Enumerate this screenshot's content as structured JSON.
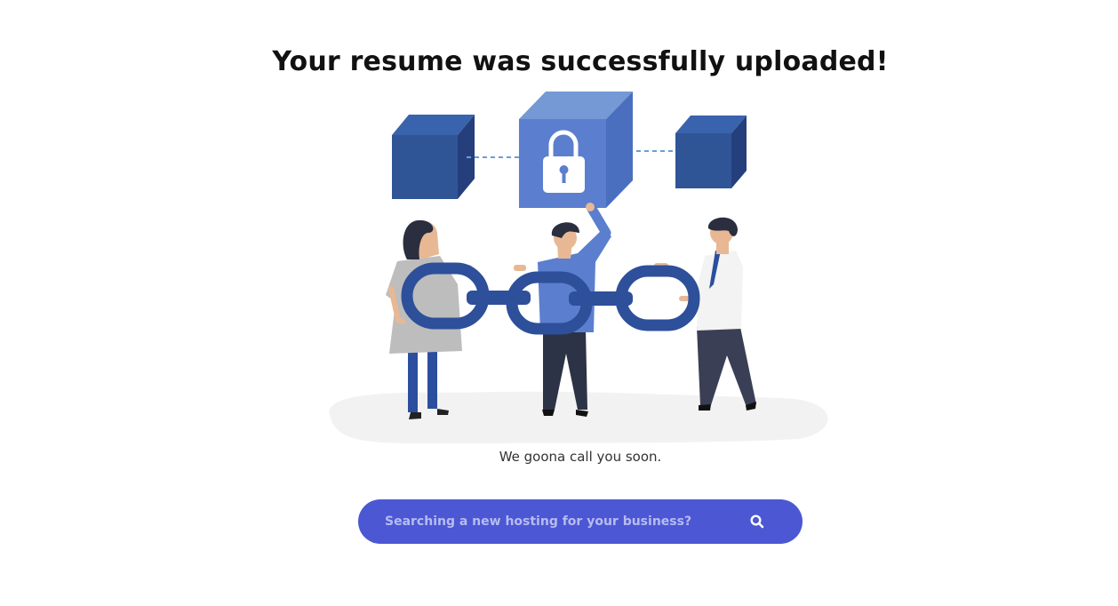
{
  "heading": "Your resume was successfully uploaded!",
  "message": "We goona call you soon.",
  "search": {
    "placeholder": "Searching a new hosting for your business?",
    "value": "",
    "icon": "search-icon"
  },
  "illustration": {
    "name": "people-holding-chain-with-secure-blocks",
    "icons": [
      "lock-icon"
    ]
  },
  "colors": {
    "accent": "#4c57d4",
    "cube_dark": "#2f5597",
    "cube_light": "#5b7fce",
    "chain": "#2e4f9a",
    "heading": "#111111",
    "placeholder": "#b7bcef"
  }
}
